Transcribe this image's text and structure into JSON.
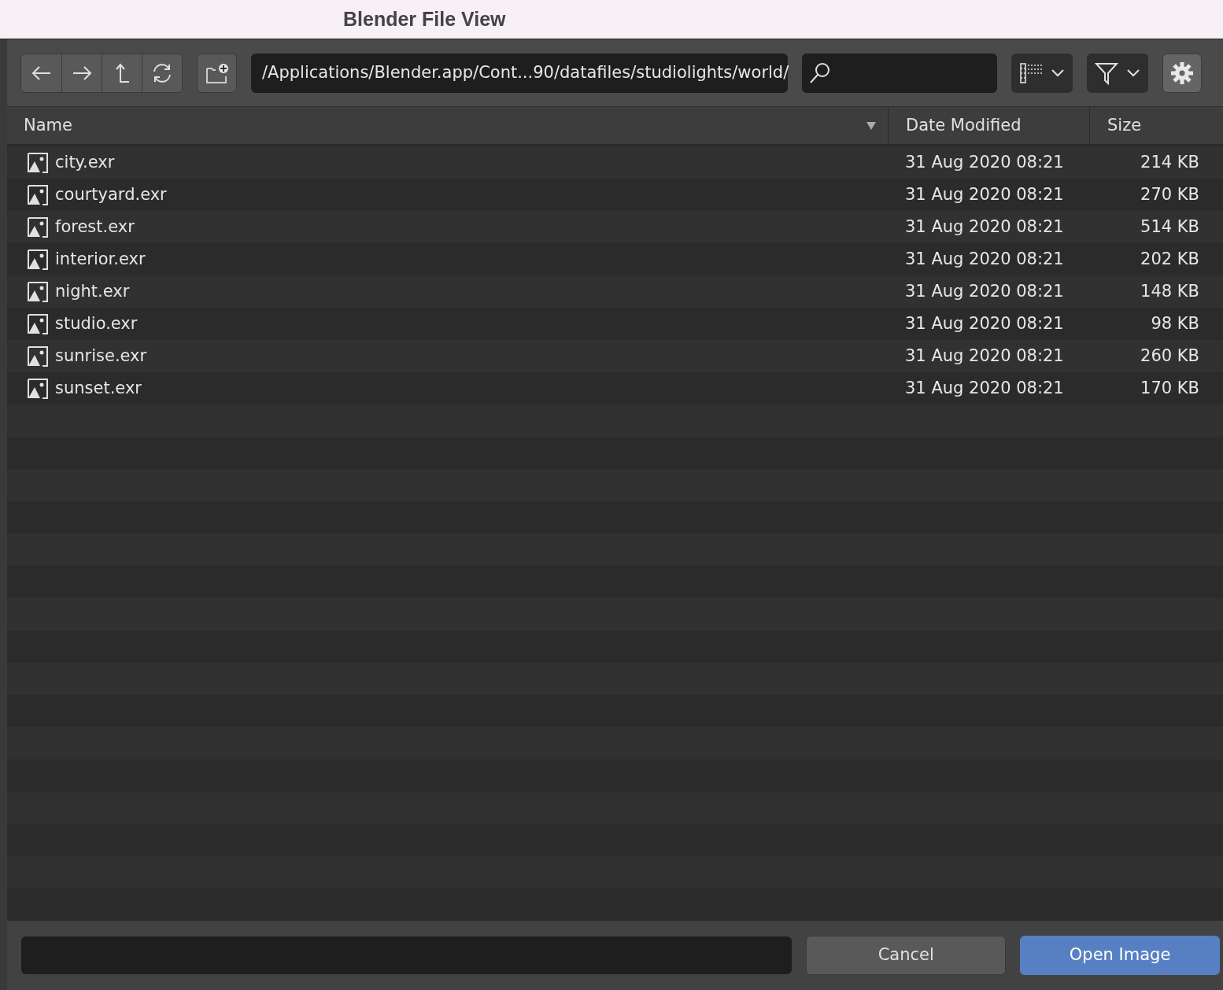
{
  "window": {
    "title": "Blender File View"
  },
  "toolbar": {
    "path": "/Applications/Blender.app/Cont...90/datafiles/studiolights/world/",
    "settings_active": true
  },
  "columns": [
    {
      "label": "Name",
      "sorted": true
    },
    {
      "label": "Date Modified",
      "sorted": false
    },
    {
      "label": "Size",
      "sorted": false
    }
  ],
  "files": [
    {
      "name": "city.exr",
      "date": "31 Aug 2020 08:21",
      "size": "214 KB"
    },
    {
      "name": "courtyard.exr",
      "date": "31 Aug 2020 08:21",
      "size": "270 KB"
    },
    {
      "name": "forest.exr",
      "date": "31 Aug 2020 08:21",
      "size": "514 KB"
    },
    {
      "name": "interior.exr",
      "date": "31 Aug 2020 08:21",
      "size": "202 KB"
    },
    {
      "name": "night.exr",
      "date": "31 Aug 2020 08:21",
      "size": "148 KB"
    },
    {
      "name": "studio.exr",
      "date": "31 Aug 2020 08:21",
      "size": "98 KB"
    },
    {
      "name": "sunrise.exr",
      "date": "31 Aug 2020 08:21",
      "size": "260 KB"
    },
    {
      "name": "sunset.exr",
      "date": "31 Aug 2020 08:21",
      "size": "170 KB"
    }
  ],
  "buttons": [
    {
      "label": "Cancel",
      "kind": "secondary"
    },
    {
      "label": "Open Image",
      "kind": "primary"
    }
  ]
}
